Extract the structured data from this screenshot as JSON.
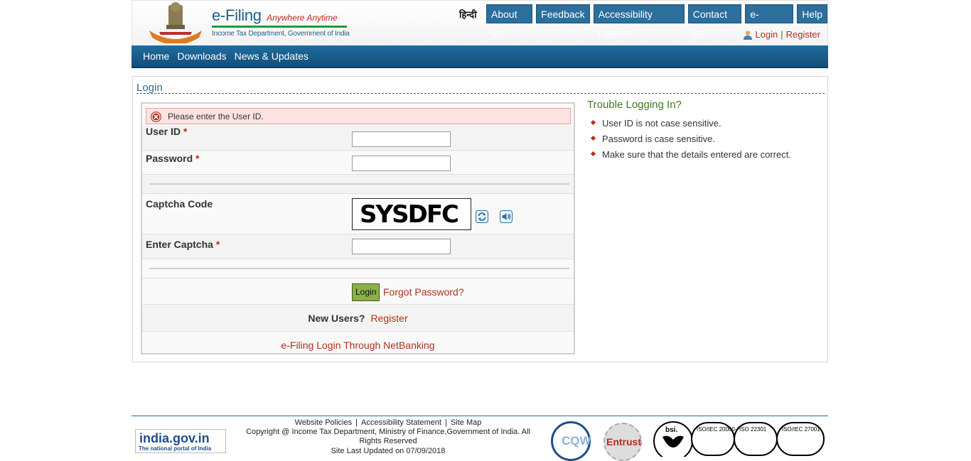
{
  "header": {
    "brand_title": "e-Filing",
    "brand_tagline": "Anywhere Anytime",
    "brand_subtitle": "Income Tax Department, Government of India",
    "hindi_link": "हिन्दी",
    "top_nav": [
      "About Us",
      "Feedback",
      "Accessibility Options",
      "Contact Us",
      "e-Nivaran",
      "Help"
    ],
    "login_link": "Login",
    "separator": "|",
    "register_link": "Register"
  },
  "main_nav": [
    "Home",
    "Downloads",
    "News & Updates"
  ],
  "login": {
    "title": "Login",
    "error_message": "Please enter the User ID.",
    "user_id_label": "User ID",
    "password_label": "Password",
    "captcha_label": "Captcha Code",
    "captcha_text": "SYSDFC",
    "enter_captcha_label": "Enter Captcha",
    "required_mark": "*",
    "user_id_value": "",
    "password_value": "",
    "captcha_value": "",
    "login_button": "Login",
    "forgot_password": "Forgot Password?",
    "new_users_label": "New Users?",
    "register_link": "Register",
    "netbanking_link": "e-Filing Login Through NetBanking"
  },
  "trouble": {
    "title": "Trouble Logging In?",
    "tips": [
      "User ID is not case sensitive.",
      "Password is case sensitive.",
      "Make sure that the details entered are correct."
    ]
  },
  "footer": {
    "links": [
      "Website Policies",
      "Accessibility Statement",
      "Site Map"
    ],
    "separator": "|",
    "copyright": "Copyright @ Income Tax Department, Ministry of Finance,Government of India. All Rights Reserved",
    "last_updated": "Site Last Updated on 07/09/2018",
    "india_gov_title": "india.gov.in",
    "india_gov_sub": "The national portal of India",
    "badge_cqw": "CQW",
    "badge_entrust": "Entrust",
    "bsi_label": "bsi.",
    "certs": [
      "ISO/IEC 20000-1",
      "ISO 22301",
      "ISO/IEC 27001"
    ]
  },
  "colors": {
    "nav_blue": "#1f6d9e",
    "link_red": "#b0301f",
    "error_bg": "#fde2e2",
    "trouble_green": "#3c7a23",
    "login_button": "#8ab04a"
  }
}
